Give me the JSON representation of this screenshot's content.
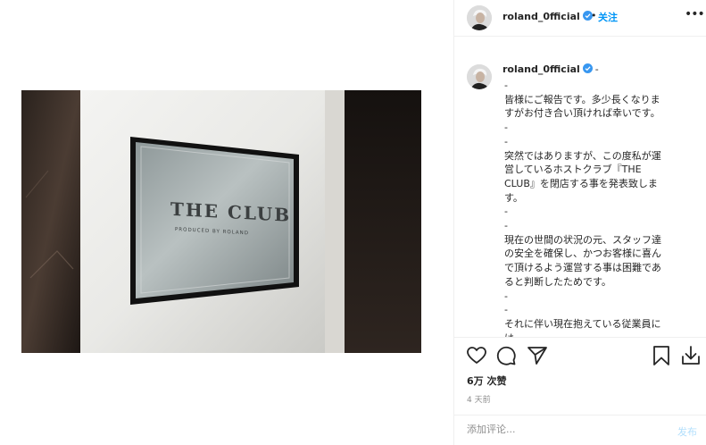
{
  "header": {
    "username": "roland_0fficial",
    "separator": "•",
    "follow_label": "关注",
    "more_label": "•••"
  },
  "photo": {
    "alt": "THE CLUB sign",
    "sign_title": "THE CLUB",
    "sign_subtitle": "PRODUCED BY ROLAND"
  },
  "caption": {
    "username": "roland_0fficial",
    "suffix": "-",
    "text": "-\n皆様にご報告です。多少長くなりま\nすがお付き合い頂ければ幸いです。\n-\n-\n突然ではありますが、この度私が運\n営しているホストクラブ『THE\nCLUB』を閉店する事を発表致しま\nす。\n-\n-\n現在の世間の状況の元、スタッフ達\nの安全を確保し、かつお客様に喜ん\nで頂けるよう運営する事は困難であ\nると判断したためです。\n-\n-\nそれに伴い現在抱えている従業員に\nは"
  },
  "actions": {
    "like_icon": "heart-icon",
    "comment_icon": "comment-icon",
    "share_icon": "paper-plane-icon",
    "save_icon": "bookmark-icon",
    "download_icon": "download-icon"
  },
  "stats": {
    "views": "6万 次赞",
    "time": "4 天前"
  },
  "comment": {
    "placeholder": "添加评论...",
    "post_label": "发布"
  },
  "colors": {
    "accent": "#0095f6",
    "verified": "#3897f0",
    "post_disabled": "#b2dffc"
  }
}
